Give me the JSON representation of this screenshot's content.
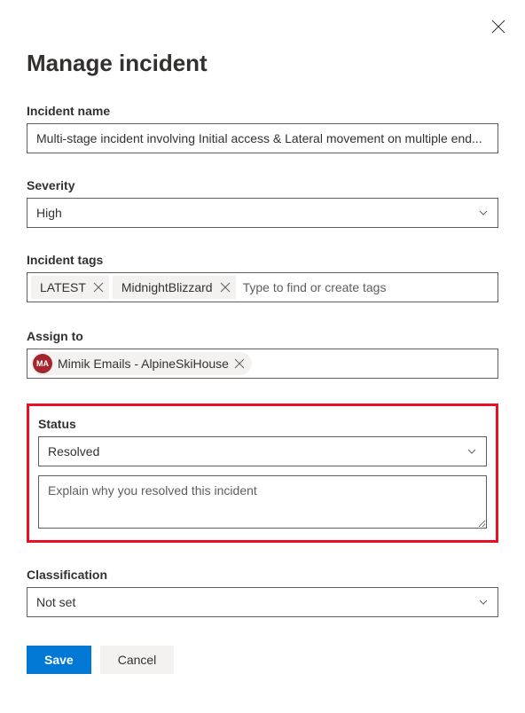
{
  "dialog": {
    "title": "Manage incident"
  },
  "fields": {
    "incident_name": {
      "label": "Incident name",
      "value": "Multi-stage incident involving Initial access & Lateral movement on multiple end..."
    },
    "severity": {
      "label": "Severity",
      "value": "High"
    },
    "incident_tags": {
      "label": "Incident tags",
      "tags": [
        {
          "label": "LATEST"
        },
        {
          "label": "MidnightBlizzard"
        }
      ],
      "placeholder": "Type to find or create tags"
    },
    "assign_to": {
      "label": "Assign to",
      "persona": {
        "initials": "MA",
        "name": "Mimik Emails - AlpineSkiHouse"
      }
    },
    "status": {
      "label": "Status",
      "value": "Resolved",
      "explain_placeholder": "Explain why you resolved this incident"
    },
    "classification": {
      "label": "Classification",
      "value": "Not set"
    }
  },
  "footer": {
    "save_label": "Save",
    "cancel_label": "Cancel"
  }
}
